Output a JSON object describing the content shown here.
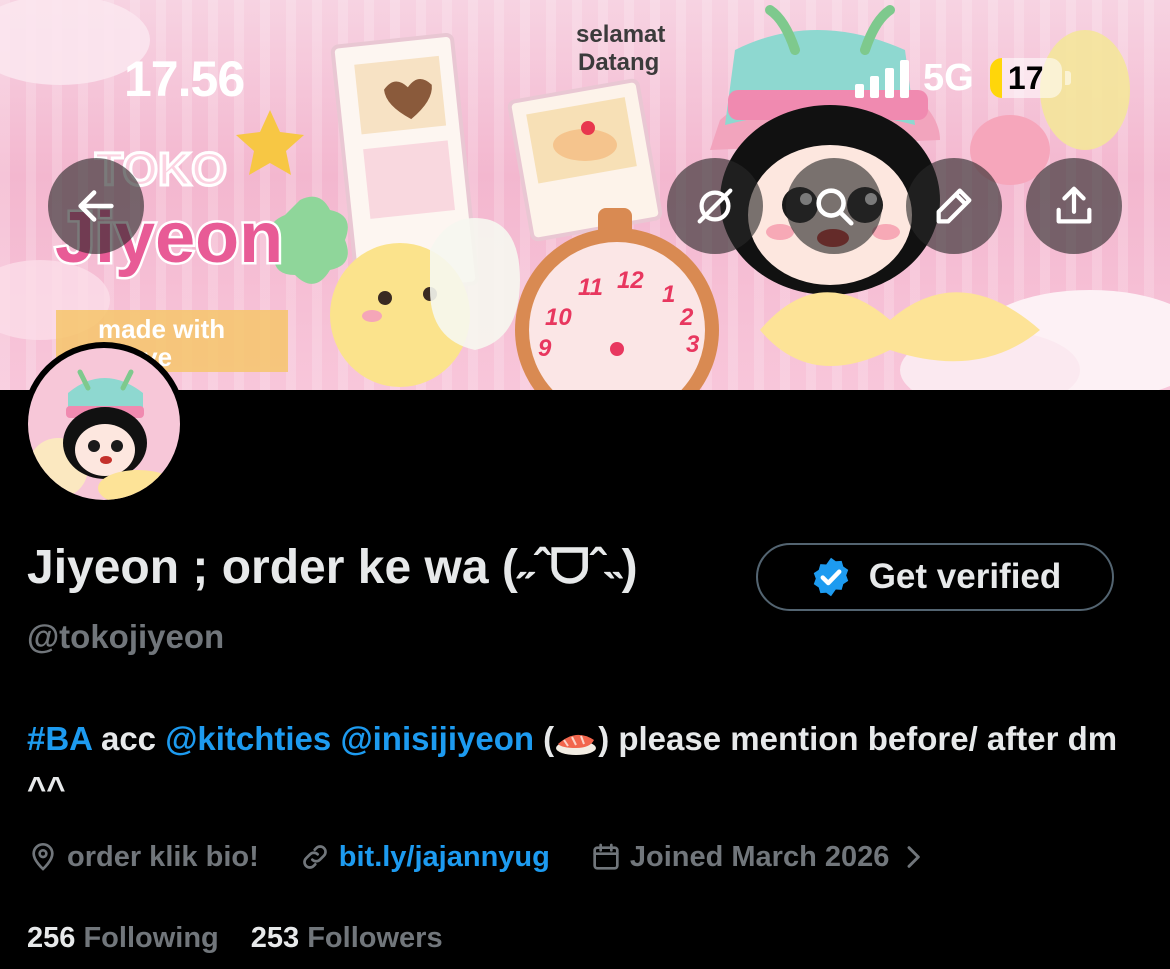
{
  "status_bar": {
    "time": "17.56",
    "network": "5G",
    "battery_level": "17",
    "battery_fraction": 0.17
  },
  "banner": {
    "greeting_line1": "selamat",
    "greeting_line2": "Datang",
    "shop_word": "TOKO",
    "shop_name": "Jiyeon",
    "tagline_line1": "made with",
    "tagline_line2": "love",
    "clock_numbers": [
      "11",
      "12",
      "1",
      "2",
      "3",
      "10",
      "9"
    ]
  },
  "header_buttons": {
    "back_icon": "arrow-left-icon",
    "grok_icon": "grok-icon",
    "search_icon": "search-icon",
    "edit_icon": "pencil-icon",
    "share_icon": "share-icon"
  },
  "profile": {
    "display_name": "Jiyeon ; order ke wa (˶ˆᗜˆ˵)",
    "handle": "@tokojiyeon",
    "verify_label": "Get verified",
    "bio": {
      "tag": "#BA",
      "text1": " acc ",
      "mention1": "@kitchties",
      "sep": " ",
      "mention2": "@inisijiyeon",
      "text2": " (",
      "text3": ") please mention before/ after dm ^^"
    },
    "location": "order klik bio!",
    "website": "bit.ly/jajannyug",
    "joined": "Joined March 2026"
  },
  "stats": {
    "following_count": "256",
    "following_label": "Following",
    "followers_count": "253",
    "followers_label": "Followers"
  },
  "colors": {
    "accent": "#1d9bf0",
    "muted": "#71767b",
    "text": "#e7e9ea",
    "background": "#000000",
    "banner_pink": "#f3b7cf"
  }
}
